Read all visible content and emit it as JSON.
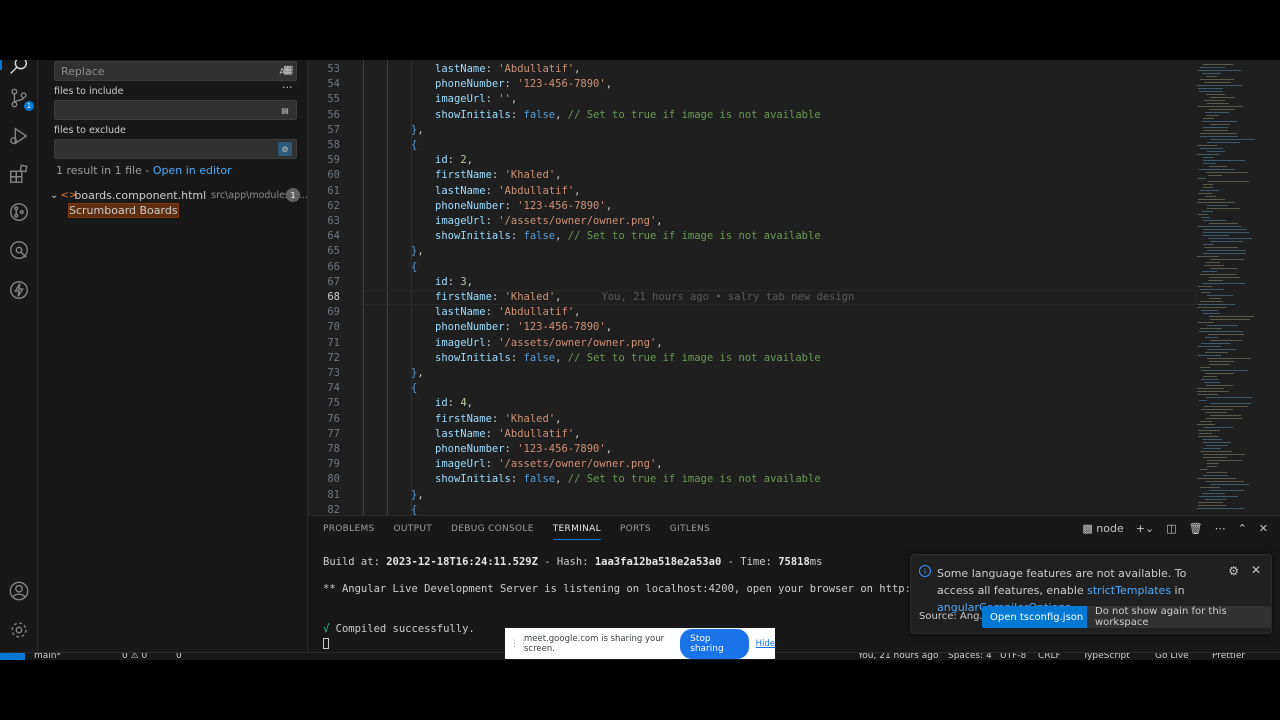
{
  "sidebar": {
    "replace_placeholder": "Replace",
    "preserve_case_label": "AB",
    "files_to_include_label": "files to include",
    "files_to_exclude_label": "files to exclude",
    "result_summary": "1 result in 1 file - ",
    "open_in_editor": "Open in editor",
    "file_name": "boards.component.html",
    "file_path": "src\\app\\modules\\a...",
    "file_match_count": "1",
    "match_text": "Scrumboard Boards",
    "more_label": "..."
  },
  "activity_bar": {
    "scm_badge": "1"
  },
  "editor": {
    "lines": [
      {
        "n": "53",
        "parts": [
          [
            "p",
            "lastName"
          ],
          [
            "w",
            ": "
          ],
          [
            "s",
            "'Abdullatif'"
          ],
          [
            "w",
            ","
          ]
        ]
      },
      {
        "n": "54",
        "parts": [
          [
            "p",
            "phoneNumber"
          ],
          [
            "w",
            ": "
          ],
          [
            "s",
            "'123-456-7890'"
          ],
          [
            "w",
            ","
          ]
        ]
      },
      {
        "n": "55",
        "parts": [
          [
            "p",
            "imageUrl"
          ],
          [
            "w",
            ": "
          ],
          [
            "s",
            "''"
          ],
          [
            "w",
            ","
          ]
        ]
      },
      {
        "n": "56",
        "parts": [
          [
            "p",
            "showInitials"
          ],
          [
            "w",
            ": "
          ],
          [
            "b",
            "false"
          ],
          [
            "w",
            ", "
          ],
          [
            "c",
            "// Set to true if image is not available"
          ]
        ]
      },
      {
        "n": "57",
        "parts": [
          [
            "pu",
            "}"
          ],
          [
            "w",
            ","
          ]
        ]
      },
      {
        "n": "58",
        "parts": [
          [
            "pu",
            "{"
          ]
        ]
      },
      {
        "n": "59",
        "parts": [
          [
            "p",
            "id"
          ],
          [
            "w",
            ": "
          ],
          [
            "n",
            "2"
          ],
          [
            "w",
            ","
          ]
        ]
      },
      {
        "n": "60",
        "parts": [
          [
            "p",
            "firstName"
          ],
          [
            "w",
            ": "
          ],
          [
            "s",
            "'Khaled'"
          ],
          [
            "w",
            ","
          ]
        ]
      },
      {
        "n": "61",
        "parts": [
          [
            "p",
            "lastName"
          ],
          [
            "w",
            ": "
          ],
          [
            "s",
            "'Abdullatif'"
          ],
          [
            "w",
            ","
          ]
        ]
      },
      {
        "n": "62",
        "parts": [
          [
            "p",
            "phoneNumber"
          ],
          [
            "w",
            ": "
          ],
          [
            "s",
            "'123-456-7890'"
          ],
          [
            "w",
            ","
          ]
        ]
      },
      {
        "n": "63",
        "parts": [
          [
            "p",
            "imageUrl"
          ],
          [
            "w",
            ": "
          ],
          [
            "s",
            "'/assets/owner/owner.png'"
          ],
          [
            "w",
            ","
          ]
        ]
      },
      {
        "n": "64",
        "parts": [
          [
            "p",
            "showInitials"
          ],
          [
            "w",
            ": "
          ],
          [
            "b",
            "false"
          ],
          [
            "w",
            ", "
          ],
          [
            "c",
            "// Set to true if image is not available"
          ]
        ]
      },
      {
        "n": "65",
        "parts": [
          [
            "pu",
            "}"
          ],
          [
            "w",
            ","
          ]
        ]
      },
      {
        "n": "66",
        "parts": [
          [
            "pu",
            "{"
          ]
        ]
      },
      {
        "n": "67",
        "parts": [
          [
            "p",
            "id"
          ],
          [
            "w",
            ": "
          ],
          [
            "n",
            "3"
          ],
          [
            "w",
            ","
          ]
        ]
      },
      {
        "n": "68",
        "parts": [
          [
            "p",
            "firstName"
          ],
          [
            "w",
            ": "
          ],
          [
            "s",
            "'Khaled'"
          ],
          [
            "w",
            ","
          ]
        ],
        "blame": "You, 21 hours ago • salry tab new design",
        "current": true
      },
      {
        "n": "69",
        "parts": [
          [
            "p",
            "lastName"
          ],
          [
            "w",
            ": "
          ],
          [
            "s",
            "'Abdullatif'"
          ],
          [
            "w",
            ","
          ]
        ]
      },
      {
        "n": "70",
        "parts": [
          [
            "p",
            "phoneNumber"
          ],
          [
            "w",
            ": "
          ],
          [
            "s",
            "'123-456-7890'"
          ],
          [
            "w",
            ","
          ]
        ]
      },
      {
        "n": "71",
        "parts": [
          [
            "p",
            "imageUrl"
          ],
          [
            "w",
            ": "
          ],
          [
            "s",
            "'/assets/owner/owner.png'"
          ],
          [
            "w",
            ","
          ]
        ]
      },
      {
        "n": "72",
        "parts": [
          [
            "p",
            "showInitials"
          ],
          [
            "w",
            ": "
          ],
          [
            "b",
            "false"
          ],
          [
            "w",
            ", "
          ],
          [
            "c",
            "// Set to true if image is not available"
          ]
        ]
      },
      {
        "n": "73",
        "parts": [
          [
            "pu",
            "}"
          ],
          [
            "w",
            ","
          ]
        ]
      },
      {
        "n": "74",
        "parts": [
          [
            "pu",
            "{"
          ]
        ]
      },
      {
        "n": "75",
        "parts": [
          [
            "p",
            "id"
          ],
          [
            "w",
            ": "
          ],
          [
            "n",
            "4"
          ],
          [
            "w",
            ","
          ]
        ]
      },
      {
        "n": "76",
        "parts": [
          [
            "p",
            "firstName"
          ],
          [
            "w",
            ": "
          ],
          [
            "s",
            "'Khaled'"
          ],
          [
            "w",
            ","
          ]
        ]
      },
      {
        "n": "77",
        "parts": [
          [
            "p",
            "lastName"
          ],
          [
            "w",
            ": "
          ],
          [
            "s",
            "'Abdullatif'"
          ],
          [
            "w",
            ","
          ]
        ]
      },
      {
        "n": "78",
        "parts": [
          [
            "p",
            "phoneNumber"
          ],
          [
            "w",
            ": "
          ],
          [
            "s",
            "'123-456-7890'"
          ],
          [
            "w",
            ","
          ]
        ]
      },
      {
        "n": "79",
        "parts": [
          [
            "p",
            "imageUrl"
          ],
          [
            "w",
            ": "
          ],
          [
            "s",
            "'/assets/owner/owner.png'"
          ],
          [
            "w",
            ","
          ]
        ]
      },
      {
        "n": "80",
        "parts": [
          [
            "p",
            "showInitials"
          ],
          [
            "w",
            ": "
          ],
          [
            "b",
            "false"
          ],
          [
            "w",
            ", "
          ],
          [
            "c",
            "// Set to true if image is not available"
          ]
        ]
      },
      {
        "n": "81",
        "parts": [
          [
            "pu",
            "}"
          ],
          [
            "w",
            ","
          ]
        ]
      },
      {
        "n": "82",
        "parts": [
          [
            "pu",
            "{"
          ]
        ]
      }
    ]
  },
  "panel": {
    "tabs": [
      "PROBLEMS",
      "OUTPUT",
      "DEBUG CONSOLE",
      "TERMINAL",
      "PORTS",
      "GITLENS"
    ],
    "active_tab": "TERMINAL",
    "terminal_shell": "node",
    "terminal": {
      "build_prefix": "Build at: ",
      "build_date": "2023-12-18T16:24:11.529Z",
      "hash_prefix": " - Hash: ",
      "hash": "1aa3fa12ba518e2a53a0",
      "time_prefix": " - Time: ",
      "time": "75818",
      "time_unit": "ms",
      "server_line": "** Angular Live Development Server is listening on localhost:4200, open your browser on http://loc",
      "check": "√",
      "compiled": " Compiled successfully."
    }
  },
  "notification": {
    "message_start": "Some language features are not available. To access all features, enable ",
    "link1": "strictTemplates",
    "message_mid": " in ",
    "link2": "angularCompilerOptions",
    "message_end": ".",
    "source": "Source: Ang...",
    "primary_button": "Open tsconfig.json",
    "secondary_button": "Do not show again for this workspace"
  },
  "status_bar": {
    "branch": "main*",
    "problems": "0 ⚠ 0",
    "ports": "0",
    "blame": "You, 21 hours ago",
    "spaces": "Spaces: 4",
    "encoding": "UTF-8",
    "eol": "CRLF",
    "language": "TypeScript",
    "golive": "Go Live",
    "prettier": "Prettier"
  },
  "share_banner": {
    "text": "meet.google.com is sharing your screen.",
    "stop_button": "Stop sharing",
    "hide_link": "Hide"
  }
}
